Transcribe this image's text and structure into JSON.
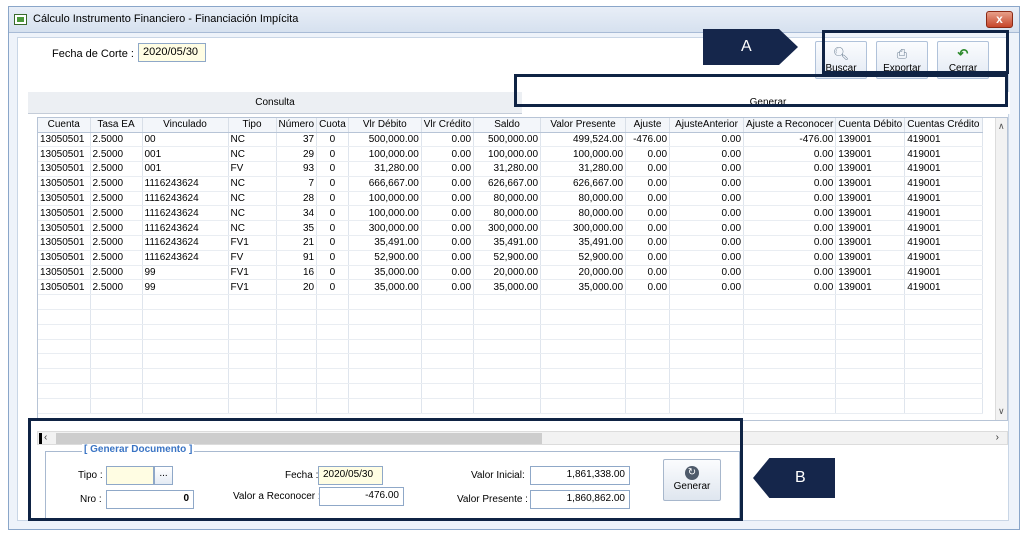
{
  "window": {
    "title": "Cálculo Instrumento Financiero - Financiación Impícita",
    "close_label": "x"
  },
  "header": {
    "fecha_corte_label": "Fecha de Corte :",
    "fecha_corte_value": "2020/05/30"
  },
  "toolbar": {
    "buscar_label": "Buscar",
    "exportar_label": "Exportar",
    "cerrar_label": "Cerrar"
  },
  "tabs": {
    "consulta": "Consulta",
    "generar": "Generar"
  },
  "grid": {
    "columns": [
      "Cuenta",
      "Tasa EA",
      "Vinculado",
      "Tipo",
      "Número",
      "Cuota",
      "Vlr Débito",
      "Vlr Crédito",
      "Saldo",
      "Valor Presente",
      "Ajuste",
      "AjusteAnterior",
      "Ajuste a Reconocer",
      "Cuenta Débito",
      "Cuentas Crédito"
    ],
    "rows": [
      [
        "13050501",
        "2.5000",
        "00",
        "NC",
        "37",
        "0",
        "500,000.00",
        "0.00",
        "500,000.00",
        "499,524.00",
        "-476.00",
        "0.00",
        "-476.00",
        "139001",
        "419001"
      ],
      [
        "13050501",
        "2.5000",
        "001",
        "NC",
        "29",
        "0",
        "100,000.00",
        "0.00",
        "100,000.00",
        "100,000.00",
        "0.00",
        "0.00",
        "0.00",
        "139001",
        "419001"
      ],
      [
        "13050501",
        "2.5000",
        "001",
        "FV",
        "93",
        "0",
        "31,280.00",
        "0.00",
        "31,280.00",
        "31,280.00",
        "0.00",
        "0.00",
        "0.00",
        "139001",
        "419001"
      ],
      [
        "13050501",
        "2.5000",
        "1116243624",
        "NC",
        "7",
        "0",
        "666,667.00",
        "0.00",
        "626,667.00",
        "626,667.00",
        "0.00",
        "0.00",
        "0.00",
        "139001",
        "419001"
      ],
      [
        "13050501",
        "2.5000",
        "1116243624",
        "NC",
        "28",
        "0",
        "100,000.00",
        "0.00",
        "80,000.00",
        "80,000.00",
        "0.00",
        "0.00",
        "0.00",
        "139001",
        "419001"
      ],
      [
        "13050501",
        "2.5000",
        "1116243624",
        "NC",
        "34",
        "0",
        "100,000.00",
        "0.00",
        "80,000.00",
        "80,000.00",
        "0.00",
        "0.00",
        "0.00",
        "139001",
        "419001"
      ],
      [
        "13050501",
        "2.5000",
        "1116243624",
        "NC",
        "35",
        "0",
        "300,000.00",
        "0.00",
        "300,000.00",
        "300,000.00",
        "0.00",
        "0.00",
        "0.00",
        "139001",
        "419001"
      ],
      [
        "13050501",
        "2.5000",
        "1116243624",
        "FV1",
        "21",
        "0",
        "35,491.00",
        "0.00",
        "35,491.00",
        "35,491.00",
        "0.00",
        "0.00",
        "0.00",
        "139001",
        "419001"
      ],
      [
        "13050501",
        "2.5000",
        "1116243624",
        "FV",
        "91",
        "0",
        "52,900.00",
        "0.00",
        "52,900.00",
        "52,900.00",
        "0.00",
        "0.00",
        "0.00",
        "139001",
        "419001"
      ],
      [
        "13050501",
        "2.5000",
        "99",
        "FV1",
        "16",
        "0",
        "35,000.00",
        "0.00",
        "20,000.00",
        "20,000.00",
        "0.00",
        "0.00",
        "0.00",
        "139001",
        "419001"
      ],
      [
        "13050501",
        "2.5000",
        "99",
        "FV1",
        "20",
        "0",
        "35,000.00",
        "0.00",
        "35,000.00",
        "35,000.00",
        "0.00",
        "0.00",
        "0.00",
        "139001",
        "419001"
      ]
    ]
  },
  "generar_documento": {
    "title": "[ Generar Documento ]",
    "tipo_label": "Tipo :",
    "tipo_value": "",
    "tipo_lookup": "...",
    "nro_label": "Nro :",
    "nro_value": "0",
    "fecha_label": "Fecha :",
    "fecha_value": "2020/05/30",
    "valor_reconocer_label": "Valor a Reconocer :",
    "valor_reconocer_value": "-476.00",
    "valor_inicial_label": "Valor Inicial:",
    "valor_inicial_value": "1,861,338.00",
    "valor_presente_label": "Valor Presente :",
    "valor_presente_value": "1,860,862.00",
    "generar_button": "Generar"
  },
  "callouts": {
    "a": "A",
    "b": "B",
    "color": "#15264b"
  }
}
